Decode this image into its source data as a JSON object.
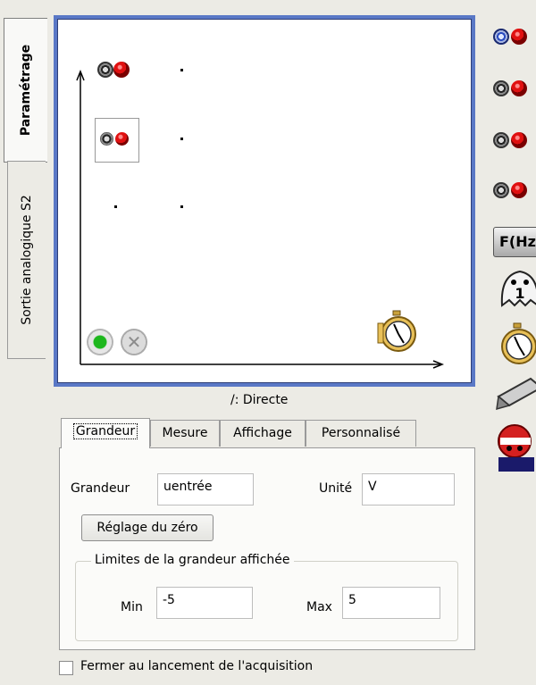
{
  "side_tabs": [
    {
      "label": "Paramétrage",
      "active": true
    },
    {
      "label": "Sortie analogique S2",
      "active": false
    }
  ],
  "graph": {
    "mode_label": "/: Directe"
  },
  "tabs": [
    {
      "label": "Grandeur",
      "active": true
    },
    {
      "label": "Mesure",
      "active": false
    },
    {
      "label": "Affichage",
      "active": false
    },
    {
      "label": "Personnalisé",
      "active": false
    }
  ],
  "grandeur_panel": {
    "grandeur_label": "Grandeur",
    "grandeur_value": "uentrée",
    "unite_label": "Unité",
    "unite_value": "V",
    "zero_button": "Réglage du zéro",
    "limits_group": "Limites de la grandeur affichée",
    "min_label": "Min",
    "min_value": "-5",
    "max_label": "Max",
    "max_value": "5"
  },
  "checkbox": {
    "label": "Fermer au lancement de l'acquisition",
    "checked": false
  },
  "right_toolbar": {
    "freq_icon_text": "F(Hz)",
    "ghost_icon_text": "1"
  },
  "colors": {
    "frame_blue": "#5a78c6",
    "connector_red": "#e01010",
    "ok_green": "#1db71d"
  }
}
